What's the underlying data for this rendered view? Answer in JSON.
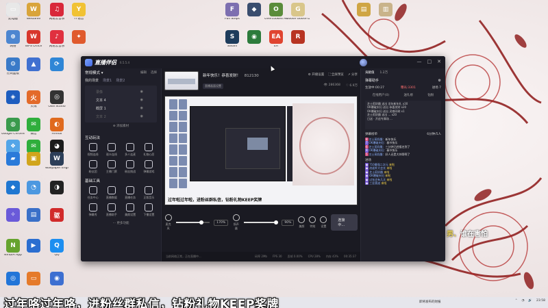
{
  "desktop": {
    "icons": [
      {
        "label": "此电脑",
        "color": "#5aa0e0",
        "glyph": "▭"
      },
      {
        "label": "WeGame",
        "color": "#d9a43a",
        "glyph": "W"
      },
      {
        "label": "网易云音乐",
        "color": "#d9283a",
        "glyph": "♫"
      },
      {
        "label": "YY语音",
        "color": "#f1c234",
        "glyph": "Y"
      },
      {
        "label": "Full Steps",
        "color": "#7d6fb0",
        "glyph": "F"
      },
      {
        "label": "",
        "color": "#3a4d6e",
        "glyph": "◆"
      },
      {
        "label": "Overcooked All You Can...",
        "color": "#5a8c3a",
        "glyph": "O"
      },
      {
        "label": "Goose Goose Duck",
        "color": "#d9c68a",
        "glyph": "G"
      },
      {
        "label": "",
        "color": "#cfa544",
        "glyph": "▤"
      },
      {
        "label": "",
        "color": "#c9b38a",
        "glyph": "▥"
      },
      {
        "label": "网络",
        "color": "#4d86d0",
        "glyph": "⊕"
      },
      {
        "label": "WPS Office",
        "color": "#d8362c",
        "glyph": "W"
      },
      {
        "label": "网易云音乐",
        "color": "#e0303f",
        "glyph": "♪"
      },
      {
        "label": "",
        "color": "#e05a2d",
        "glyph": "✦"
      },
      {
        "label": "Steam",
        "color": "#1e3c5c",
        "glyph": "S"
      },
      {
        "label": "",
        "color": "#2d7b3c",
        "glyph": "◉"
      },
      {
        "label": "EA",
        "color": "#e04430",
        "glyph": "EA"
      },
      {
        "label": "",
        "color": "#b83422",
        "glyph": "R"
      },
      {
        "label": "控制面板",
        "color": "#3a7ac8",
        "glyph": "⚙"
      },
      {
        "label": "",
        "color": "#4070d0",
        "glyph": "▲"
      },
      {
        "label": "",
        "color": "#2f86d6",
        "glyph": "⟳"
      },
      {
        "label": "",
        "color": "#1e5dbf",
        "glyph": "◈"
      },
      {
        "label": "火绒",
        "color": "#e36a2a",
        "glyph": "火"
      },
      {
        "label": "OBS Studio",
        "color": "#333",
        "glyph": "◎"
      },
      {
        "label": "Google Chrome",
        "color": "#3a9a4c",
        "glyph": "◍"
      },
      {
        "label": "微信",
        "color": "#2fae3c",
        "glyph": "✉"
      },
      {
        "label": "Firefox",
        "color": "#e06a1e",
        "glyph": "◐"
      },
      {
        "label": "",
        "color": "#53a5e8",
        "glyph": "❖"
      },
      {
        "label": "WeChat",
        "color": "#2fae3c",
        "glyph": "✉"
      },
      {
        "label": "",
        "color": "#1b1b1b",
        "glyph": "◕"
      },
      {
        "label": "",
        "color": "#2a7ad9",
        "glyph": "▰"
      },
      {
        "label": "",
        "color": "#d1a51c",
        "glyph": "▣"
      },
      {
        "label": "Wallpaper Engine",
        "color": "#2c3e58",
        "glyph": "W"
      },
      {
        "label": "",
        "color": "#1f77d1",
        "glyph": "◆"
      },
      {
        "label": "",
        "color": "#4c98e0",
        "glyph": "◔"
      },
      {
        "label": "",
        "color": "#222",
        "glyph": "◑"
      },
      {
        "label": "",
        "color": "#6a5ad9",
        "glyph": "✧"
      },
      {
        "label": "",
        "color": "#3a70c8",
        "glyph": "▤"
      },
      {
        "label": "",
        "color": "#d12a2a",
        "glyph": "驱"
      },
      {
        "label": "NVIDIA App",
        "color": "#66a32e",
        "glyph": "N"
      },
      {
        "label": "",
        "color": "#2b6ed0",
        "glyph": "▶"
      },
      {
        "label": "QQ",
        "color": "#1c8ef0",
        "glyph": "Q"
      },
      {
        "label": "",
        "color": "#2275d8",
        "glyph": "◎"
      },
      {
        "label": "",
        "color": "#e57a2a",
        "glyph": "▭"
      },
      {
        "label": "",
        "color": "#3c6fd1",
        "glyph": "◉"
      },
      {
        "label": "",
        "color": "#e8e8e8",
        "glyph": "▭"
      }
    ]
  },
  "app": {
    "name": "直播伴侣",
    "version": "6.5.5.4",
    "window_controls": [
      "—",
      "□",
      "✕"
    ],
    "left": {
      "mode": "常规模式",
      "mode_actions": [
        "编辑",
        "选择"
      ],
      "scene_label": "我的场景",
      "scene_tags": [
        "场景1",
        "场景2"
      ],
      "sources": [
        {
          "name": "录像",
          "dim": true
        },
        {
          "name": "文本 4",
          "dim": false
        },
        {
          "name": "截屏 1",
          "dim": false
        },
        {
          "name": "文本 2",
          "dim": true
        }
      ],
      "add_source": "添加素材",
      "interact_title": "互动玩法",
      "interact_items": [
        "视频连线",
        "观众连线",
        "多人连麦",
        "礼物心愿",
        "粉丝团",
        "主播门票",
        "粉丝挑战",
        "弹幕游戏"
      ],
      "tools_title": "基础工具",
      "tool_items": [
        "任务中心",
        "直播数据",
        "直播任务",
        "正版音乐",
        "弹幕秀",
        "直播助手",
        "美颜设置",
        "下播设置"
      ],
      "more": "更多功能"
    },
    "center": {
      "stream_title": "新年快乐！恭喜发财！",
      "stream_id": "812130",
      "chip": "直播画面设置",
      "top_actions": [
        "开播设置",
        "全屏预览",
        "分享"
      ],
      "top_stats": [
        "286368",
        "6.9万"
      ],
      "preview_caption": "过年啦过年啦，进粉丝群私信，钻粉礼物KEEP奖牌",
      "controls": {
        "mic_label": "麦克风",
        "mic_pct": "170%",
        "speaker_label": "扬声器",
        "speaker_pct": "90%",
        "beauty_label": "美颜",
        "effects_label": "特效",
        "settings_label": "设置",
        "go_live": "连接中..."
      },
      "status_left": "当前网络正常，正在直播中...",
      "status_stats": [
        "码率 2Mb",
        "FPS 30",
        "丢帧 0.00%",
        "CPU 28%",
        "内存 43%",
        "00:35:37"
      ]
    },
    "right": {
      "tabs": [
        "贡献值",
        "1.2万"
      ],
      "assistant": "弹幕助手",
      "stats": {
        "live_time": "生放中:00:27",
        "viewers": "曝光:3301",
        "trend": "进场 7"
      },
      "sub_tabs": [
        "在线用户(0)",
        "送礼榜",
        "钻粉"
      ],
      "gift_lines": [
        "芝士煎奶酪 送出 龙年新年礼 x30",
        "OK爆破夫妇 送出 恭喜发财 x20",
        "OK爆破夫妇 送出 灵感印刷 x1",
        "芝士煎奶酪 送出 ... x20",
        "日送 · 开追专属场 ..."
      ],
      "rank_title": "弹幕榜单",
      "rank_count": "6分钟/5人",
      "messages": [
        {
          "badge": "8",
          "name": "芝士煎奶酪",
          "text": "新年快乐"
        },
        {
          "badge": "7",
          "name": "OK爆破夫妇",
          "text": "春节快乐"
        },
        {
          "badge": "6",
          "name": "芝士煎奶酪",
          "text": "三分钟已经报名到了"
        },
        {
          "badge": "9",
          "name": "OK爆破夫妇",
          "text": "春节快乐"
        },
        {
          "badge": "5",
          "name": "芝士煎奶酪",
          "text": "好人还是大帅哥啊了"
        }
      ],
      "entry_title": "进场",
      "entries": [
        {
          "name": "710最强二次元",
          "text": "来啦"
        },
        {
          "name": "逍遥朴大会先",
          "text": "来啦"
        },
        {
          "name": "芝士煎奶酪",
          "text": "来啦"
        },
        {
          "name": "OK爆破夫妇",
          "text": "来啦"
        },
        {
          "name": "过年还有几天",
          "text": "来啦"
        },
        {
          "name": "三亚奥迪",
          "text": "来啦"
        }
      ]
    }
  },
  "overlay": {
    "floating_prefix": "男、",
    "floating_text": "谁在害怕",
    "subtitle": "过年咯过年咯，进粉丝群私信，钻粉礼物KEEP奖牌"
  },
  "taskbar": {
    "weather": "即将发布的财报",
    "time": "23:58"
  }
}
